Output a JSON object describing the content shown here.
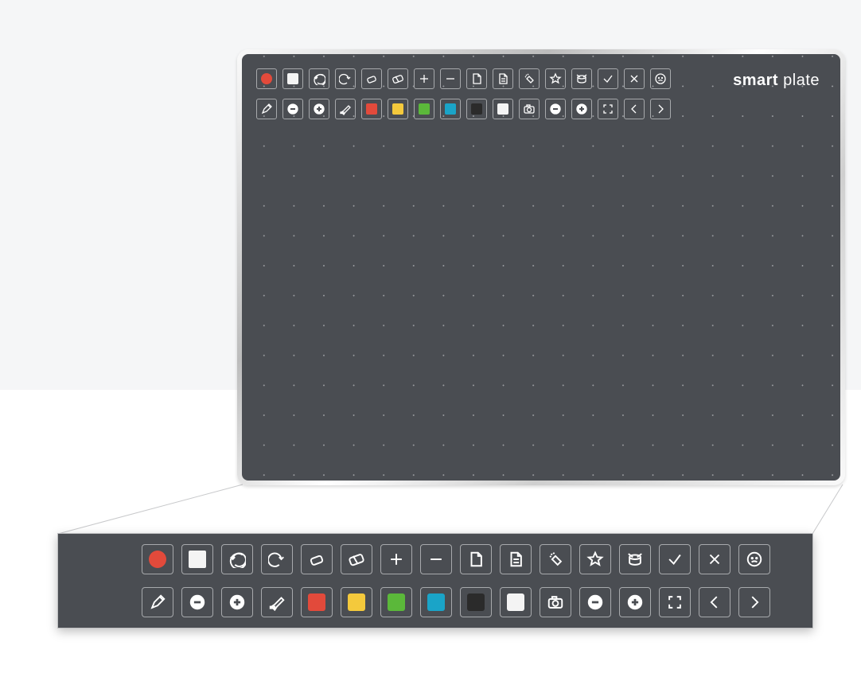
{
  "brand": {
    "bold": "smart",
    "light": "plate"
  },
  "colors": {
    "red": "#e24a3b",
    "yellow": "#f4c93c",
    "green": "#5bb83a",
    "teal": "#1aa4c8",
    "black": "#2b2b2b",
    "white": "#f4f4f4"
  },
  "toolbar_rows": [
    [
      {
        "name": "record-button",
        "icon": "dot",
        "color_key": "red",
        "shape": "circle"
      },
      {
        "name": "stop-button",
        "icon": "square-fill",
        "color_key": "white"
      },
      {
        "name": "undo-button",
        "icon": "undo"
      },
      {
        "name": "redo-button",
        "icon": "redo"
      },
      {
        "name": "eraser-small-button",
        "icon": "eraser"
      },
      {
        "name": "eraser-large-button",
        "icon": "eraser-big"
      },
      {
        "name": "add-button",
        "icon": "plus"
      },
      {
        "name": "remove-button",
        "icon": "minus"
      },
      {
        "name": "page-button",
        "icon": "page"
      },
      {
        "name": "document-button",
        "icon": "doc"
      },
      {
        "name": "clap-button",
        "icon": "clap"
      },
      {
        "name": "star-button",
        "icon": "star"
      },
      {
        "name": "drum-button",
        "icon": "drum"
      },
      {
        "name": "confirm-button",
        "icon": "check"
      },
      {
        "name": "cancel-button",
        "icon": "x"
      },
      {
        "name": "face-button",
        "icon": "face"
      }
    ],
    [
      {
        "name": "pen-button",
        "icon": "pen"
      },
      {
        "name": "decrease-button",
        "icon": "circle-minus"
      },
      {
        "name": "increase-button",
        "icon": "circle-plus"
      },
      {
        "name": "highlighter-button",
        "icon": "highlighter"
      },
      {
        "name": "color-red-button",
        "icon": "swatch",
        "color_key": "red"
      },
      {
        "name": "color-yellow-button",
        "icon": "swatch",
        "color_key": "yellow"
      },
      {
        "name": "color-green-button",
        "icon": "swatch",
        "color_key": "green"
      },
      {
        "name": "color-teal-button",
        "icon": "swatch",
        "color_key": "teal"
      },
      {
        "name": "color-black-button",
        "icon": "swatch",
        "color_key": "black"
      },
      {
        "name": "color-white-button",
        "icon": "swatch",
        "color_key": "white"
      },
      {
        "name": "camera-button",
        "icon": "camera"
      },
      {
        "name": "zoom-out-button",
        "icon": "circle-minus"
      },
      {
        "name": "zoom-in-button",
        "icon": "circle-plus"
      },
      {
        "name": "fullscreen-button",
        "icon": "expand"
      },
      {
        "name": "prev-button",
        "icon": "chevron-left"
      },
      {
        "name": "next-button",
        "icon": "chevron-right"
      }
    ]
  ]
}
